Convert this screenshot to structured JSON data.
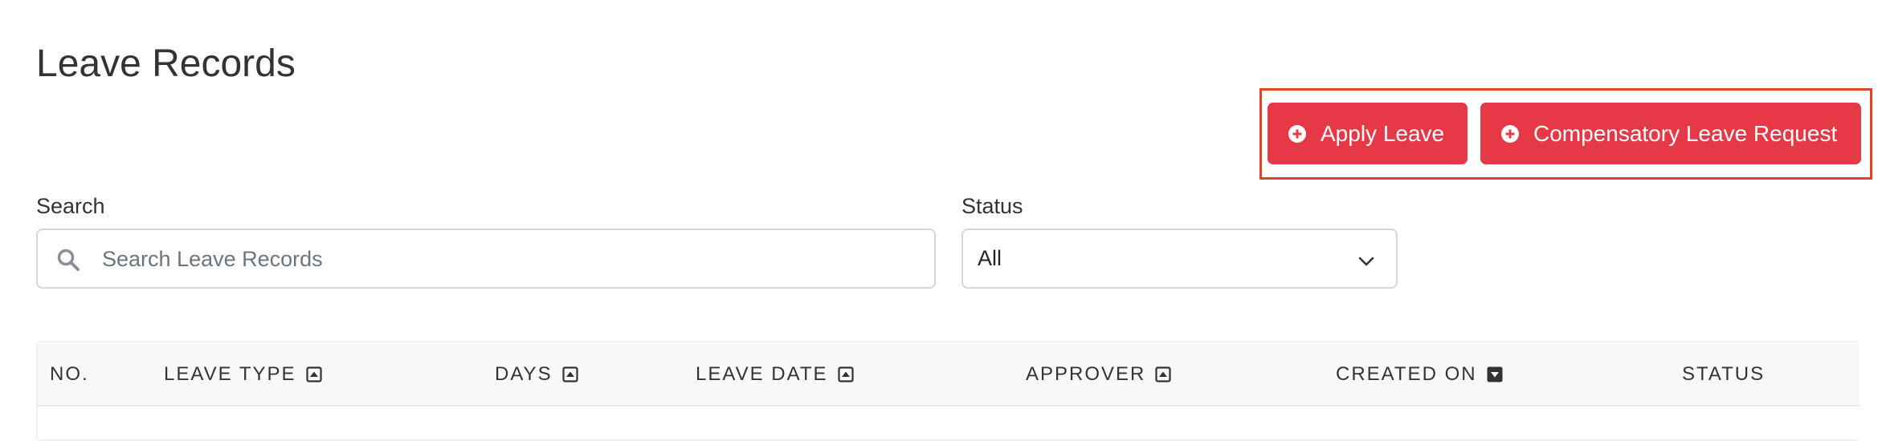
{
  "header": {
    "title": "Leave Records"
  },
  "actions": {
    "apply_leave": {
      "label": "Apply Leave",
      "icon": "plus-circle-icon"
    },
    "compensatory_leave": {
      "label": "Compensatory Leave Request",
      "icon": "plus-circle-icon"
    },
    "button_color": "#e63946",
    "highlight_color": "#e0452b"
  },
  "filters": {
    "search": {
      "label": "Search",
      "placeholder": "Search Leave Records",
      "value": "",
      "icon": "search-icon"
    },
    "status": {
      "label": "Status",
      "selected": "All",
      "icon": "chevron-down-icon"
    }
  },
  "table": {
    "columns": [
      {
        "label": "NO.",
        "sortable": false
      },
      {
        "label": "LEAVE TYPE",
        "sortable": true,
        "sort_icon": "sort-up-icon"
      },
      {
        "label": "DAYS",
        "sortable": true,
        "sort_icon": "sort-up-icon"
      },
      {
        "label": "LEAVE DATE",
        "sortable": true,
        "sort_icon": "sort-up-icon"
      },
      {
        "label": "APPROVER",
        "sortable": true,
        "sort_icon": "sort-up-icon"
      },
      {
        "label": "CREATED ON",
        "sortable": true,
        "sort_icon": "sort-down-active-icon"
      },
      {
        "label": "STATUS",
        "sortable": false
      }
    ],
    "rows": []
  }
}
